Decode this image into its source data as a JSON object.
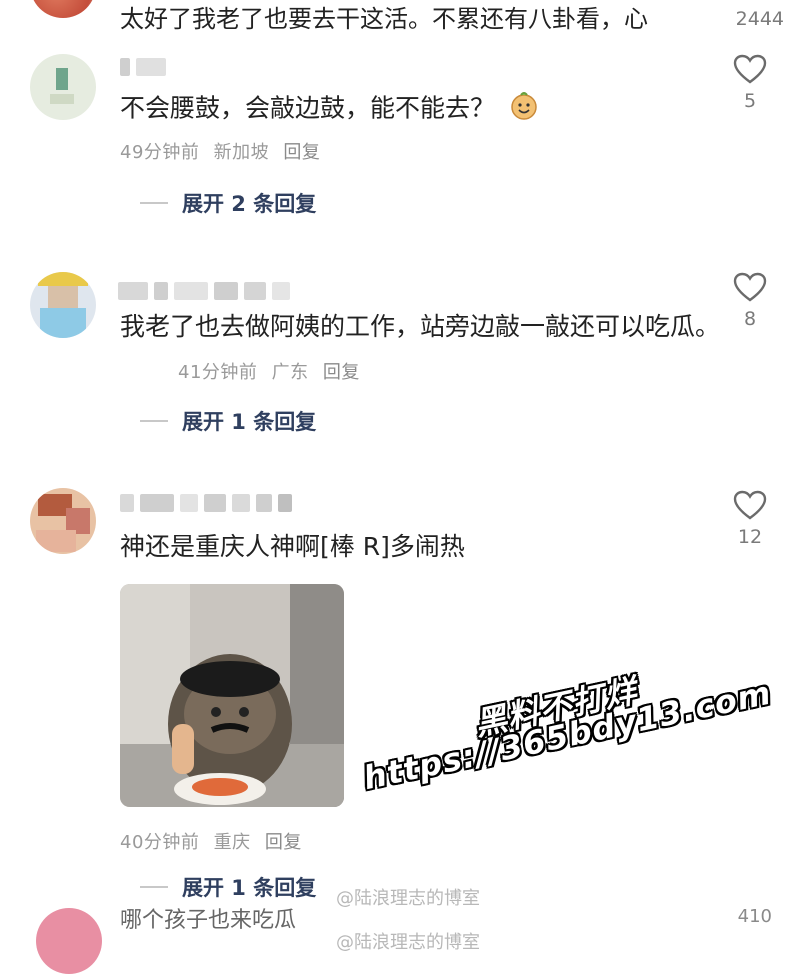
{
  "comments": [
    {
      "text": "太好了我老了也要去干这活。不累还有八卦看，心",
      "likes": "2444"
    },
    {
      "text": "不会腰鼓，会敲边鼓，能不能去？",
      "emoji_icon": "smiling-bun-emoji-icon",
      "time": "49分钟前",
      "location": "新加坡",
      "reply_label": "回复",
      "likes": "5",
      "expand_label": "展开 2 条回复"
    },
    {
      "text": "我老了也去做阿姨的工作，站旁边敲一敲还可以吃瓜。",
      "time": "41分钟前",
      "location": "广东",
      "reply_label": "回复",
      "likes": "8",
      "expand_label": "展开 1 条回复"
    },
    {
      "text": "神还是重庆人神啊[棒 R]多闹热",
      "time": "40分钟前",
      "location": "重庆",
      "reply_label": "回复",
      "likes": "12",
      "expand_label": "展开 1 条回复",
      "image_icon": "cat-with-beret-photo"
    },
    {
      "text": "哪个孩子也来吃瓜",
      "likes": "410"
    }
  ],
  "watermark": {
    "line1": "黑料不打烊",
    "line2": "https://365bdy13.com"
  },
  "source_watermark": "@陆浪理志的博室",
  "colors": {
    "meta": "#9a9a9a",
    "expand": "#2f3f5f",
    "heart": "#6b6b6b"
  }
}
